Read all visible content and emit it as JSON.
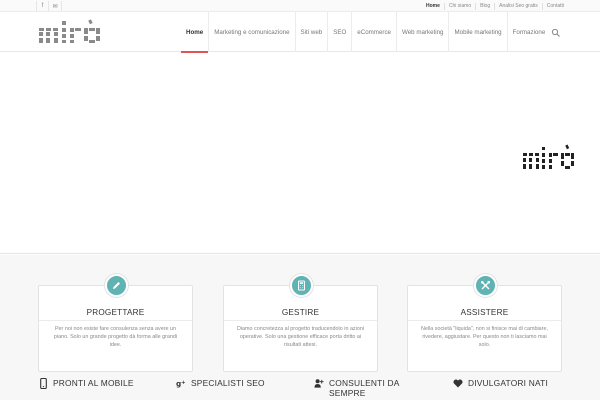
{
  "topbar": {
    "social": [
      {
        "name": "facebook-icon",
        "glyph": "f"
      },
      {
        "name": "mail-icon",
        "glyph": "✉"
      }
    ],
    "links": [
      "Home",
      "Chi siamo",
      "Blog",
      "Analisi Seo gratis",
      "Contatti"
    ]
  },
  "header": {
    "logo_text": "mirò",
    "nav": [
      "Home",
      "Marketing e comunicazione",
      "Siti web",
      "SEO",
      "eCommerce",
      "Web marketing",
      "Mobile marketing",
      "Formazione"
    ]
  },
  "hero": {
    "logo_text": "mirò"
  },
  "cards": [
    {
      "title": "PROGETTARE",
      "icon": "pencil-icon",
      "text": "Per noi non esiste fare consulenza senza avere un piano. Solo un grande progetto dà forma alle grandi idee."
    },
    {
      "title": "GESTIRE",
      "icon": "calculator-icon",
      "text": "Diamo concretezza al progetto traducendolo in azioni operative. Solo una gestione efficace porta dritto ai risultati attesi."
    },
    {
      "title": "ASSISTERE",
      "icon": "tools-icon",
      "text": "Nella società \"liquida\", non si finisce mai di cambiare, rivedere, aggiustare. Per questo non ti lasciamo mai solo."
    }
  ],
  "features": [
    {
      "title": "PRONTI AL MOBILE",
      "icon": "mobile-icon"
    },
    {
      "title": "SPECIALISTI SEO",
      "icon": "google-plus-icon"
    },
    {
      "title": "CONSULENTI DA SEMPRE",
      "icon": "add-user-icon"
    },
    {
      "title": "DIVULGATORI NATI",
      "icon": "heart-icon"
    }
  ],
  "colors": {
    "accent": "#e25555",
    "icon_circle": "#5fb3b3",
    "logo": "#8a8a8a"
  }
}
